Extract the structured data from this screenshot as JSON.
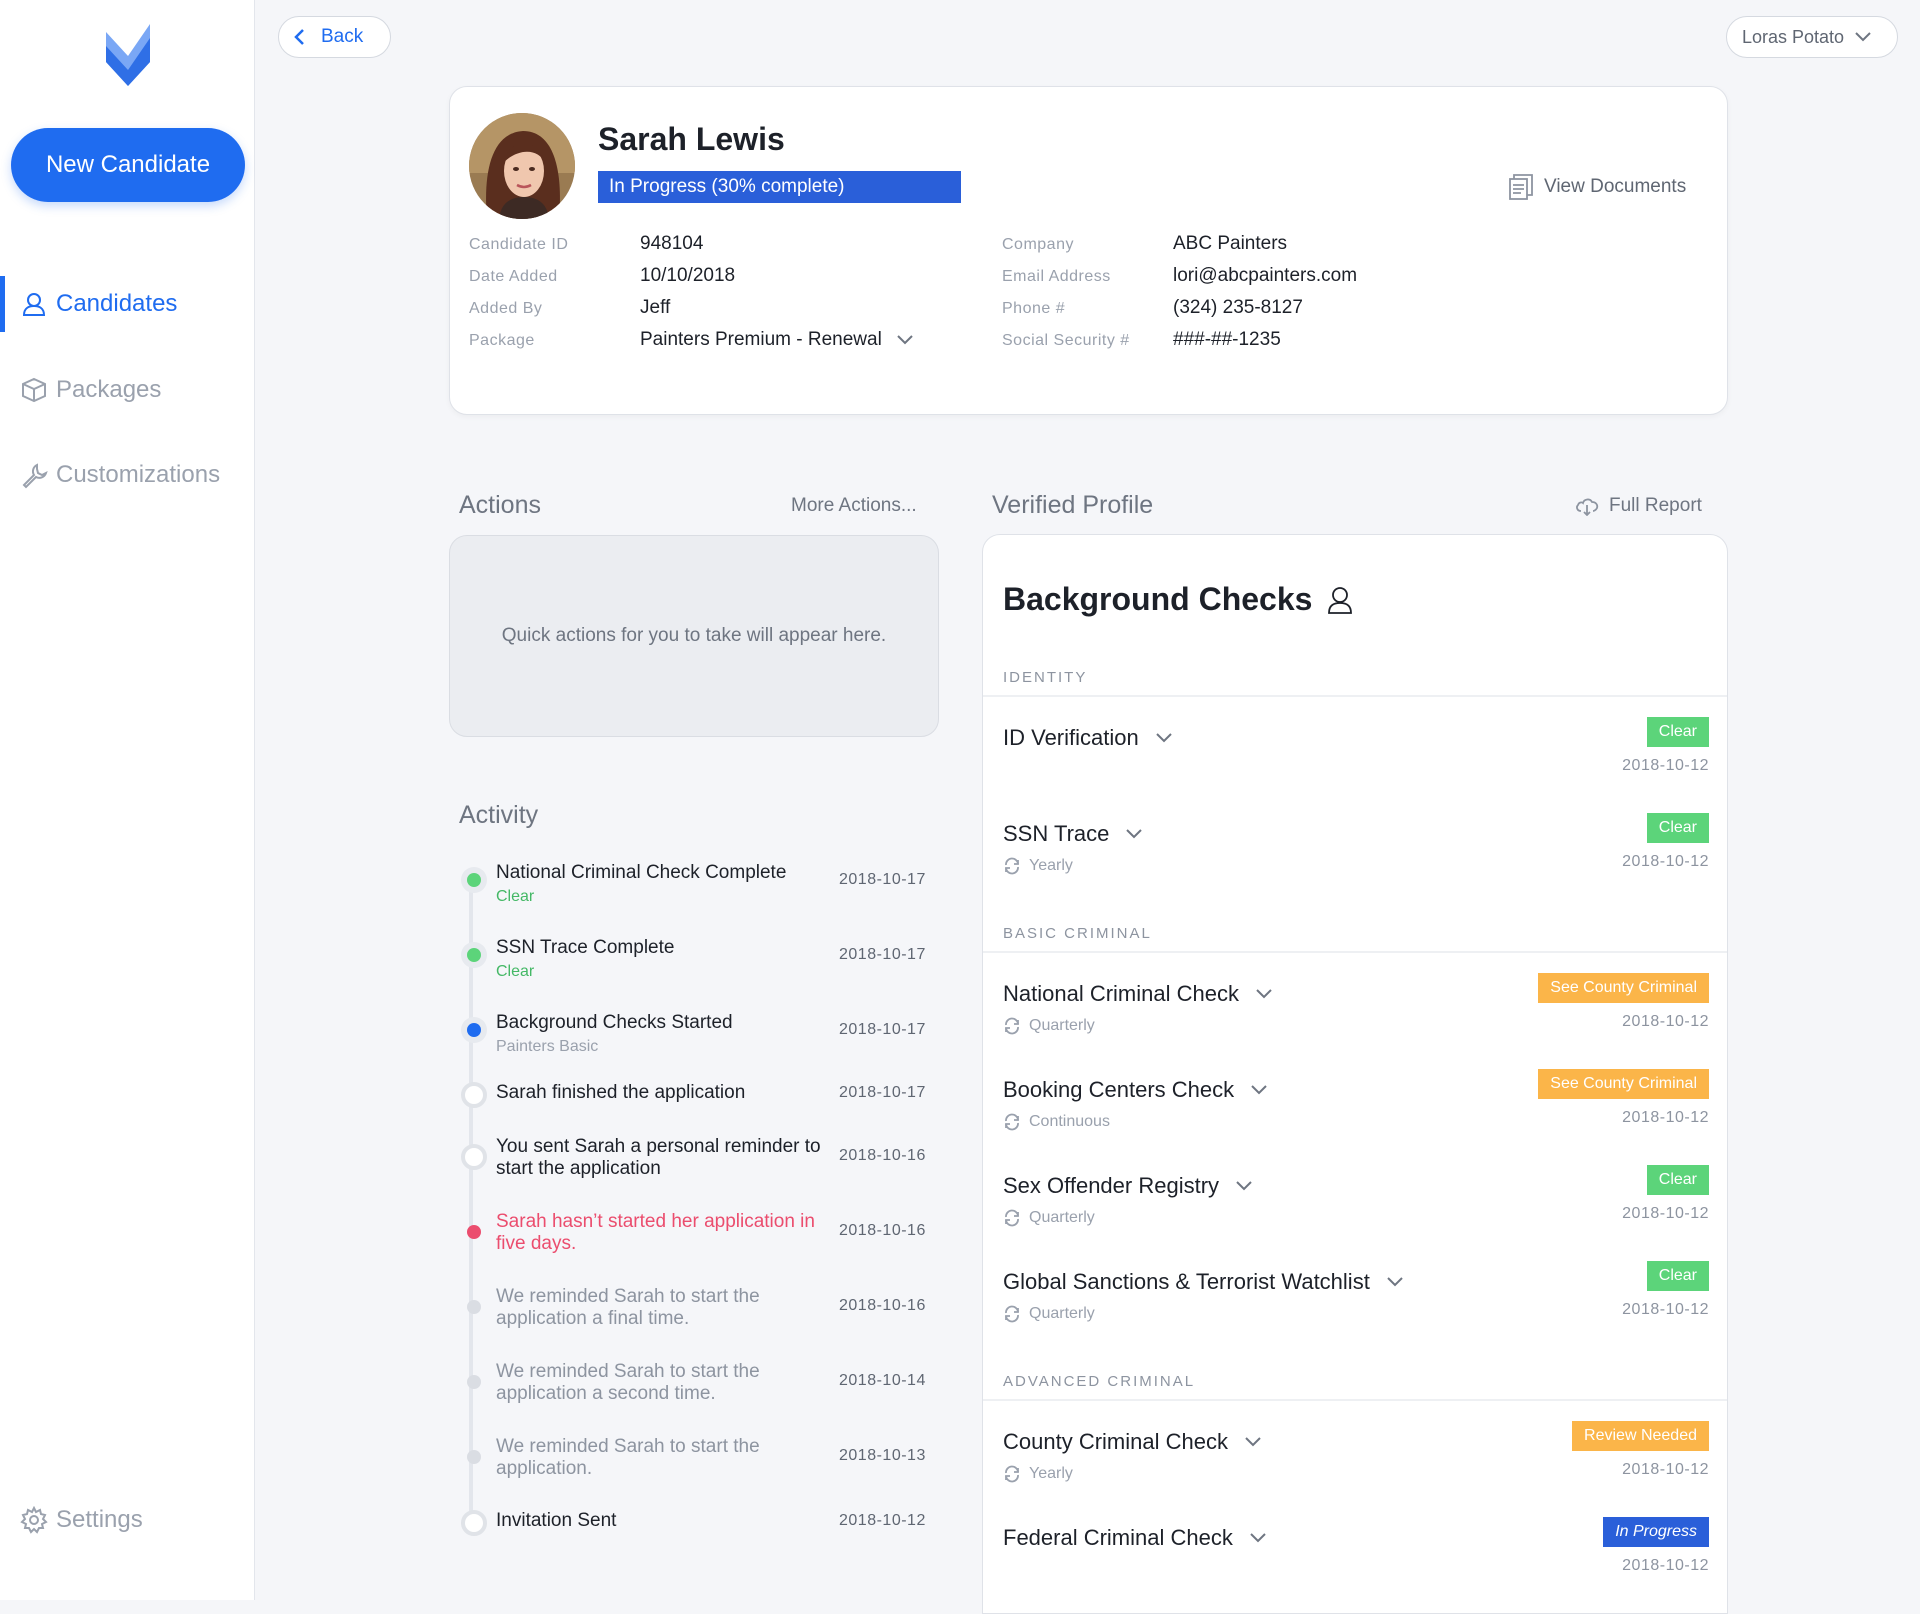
{
  "sidebar": {
    "new_candidate": "New Candidate",
    "nav": [
      {
        "label": "Candidates",
        "icon": "user-icon",
        "active": true
      },
      {
        "label": "Packages",
        "icon": "box-icon",
        "active": false
      },
      {
        "label": "Customizations",
        "icon": "wrench-icon",
        "active": false
      }
    ],
    "settings": "Settings"
  },
  "topbar": {
    "back": "Back",
    "user": "Loras Potato"
  },
  "candidate": {
    "name": "Sarah Lewis",
    "status": "In Progress (30% complete)",
    "progress_pct": 30,
    "view_documents": "View Documents",
    "fields_left": [
      {
        "label": "Candidate ID",
        "value": "948104"
      },
      {
        "label": "Date Added",
        "value": "10/10/2018"
      },
      {
        "label": "Added By",
        "value": "Jeff"
      },
      {
        "label": "Package",
        "value": "Painters Premium - Renewal"
      }
    ],
    "fields_right": [
      {
        "label": "Company",
        "value": "ABC Painters"
      },
      {
        "label": "Email Address",
        "value": "lori@abcpainters.com"
      },
      {
        "label": "Phone #",
        "value": "(324) 235-8127"
      },
      {
        "label": "Social Security #",
        "value": "###-##-1235"
      }
    ]
  },
  "actions": {
    "title": "Actions",
    "more": "More Actions...",
    "empty": "Quick actions for you to take will appear here."
  },
  "activity": {
    "title": "Activity",
    "items": [
      {
        "title": "National Criminal Check Complete",
        "sub": "Clear",
        "date": "2018-10-17"
      },
      {
        "title": "SSN Trace Complete",
        "sub": "Clear",
        "date": "2018-10-17"
      },
      {
        "title": "Background Checks Started",
        "sub": "Painters Basic",
        "date": "2018-10-17"
      },
      {
        "title": "Sarah finished the application",
        "sub": "",
        "date": "2018-10-17"
      },
      {
        "title": "You sent Sarah a personal reminder to start the application",
        "sub": "",
        "date": "2018-10-16"
      },
      {
        "title": "Sarah hasn’t started her application in five days.",
        "sub": "",
        "date": "2018-10-16"
      },
      {
        "title": "We reminded Sarah to start the application a final time.",
        "sub": "",
        "date": "2018-10-16"
      },
      {
        "title": "We reminded Sarah to start the application a second time.",
        "sub": "",
        "date": "2018-10-14"
      },
      {
        "title": "We reminded Sarah to start the application.",
        "sub": "",
        "date": "2018-10-13"
      },
      {
        "title": "Invitation Sent",
        "sub": "",
        "date": "2018-10-12"
      }
    ]
  },
  "verified_profile": {
    "title": "Verified Profile",
    "full_report": "Full Report",
    "heading": "Background Checks",
    "groups": [
      {
        "label": "IDENTITY"
      },
      {
        "label": "BASIC CRIMINAL"
      },
      {
        "label": "ADVANCED CRIMINAL"
      }
    ],
    "checks": [
      {
        "name": "ID Verification",
        "freq": "",
        "status": "Clear",
        "date": "2018-10-12"
      },
      {
        "name": "SSN Trace",
        "freq": "Yearly",
        "status": "Clear",
        "date": "2018-10-12"
      },
      {
        "name": "National Criminal Check",
        "freq": "Quarterly",
        "status": "See County Criminal",
        "date": "2018-10-12"
      },
      {
        "name": "Booking Centers Check",
        "freq": "Continuous",
        "status": "See County Criminal",
        "date": "2018-10-12"
      },
      {
        "name": "Sex Offender Registry",
        "freq": "Quarterly",
        "status": "Clear",
        "date": "2018-10-12"
      },
      {
        "name": "Global Sanctions & Terrorist Watchlist",
        "freq": "Quarterly",
        "status": "Clear",
        "date": "2018-10-12"
      },
      {
        "name": "County Criminal Check",
        "freq": "Yearly",
        "status": "Review Needed",
        "date": "2018-10-12"
      },
      {
        "name": "Federal Criminal Check",
        "freq": "",
        "status": "In Progress",
        "date": "2018-10-12"
      }
    ]
  },
  "colors": {
    "accent": "#1f6cf0",
    "progress_bar": "#2a5fd9",
    "clear": "#5cd47a",
    "warning": "#fbb549",
    "in_progress": "#2a5fd9",
    "alert": "#eb4d6e",
    "dot_blue": "#1f6cf0"
  }
}
